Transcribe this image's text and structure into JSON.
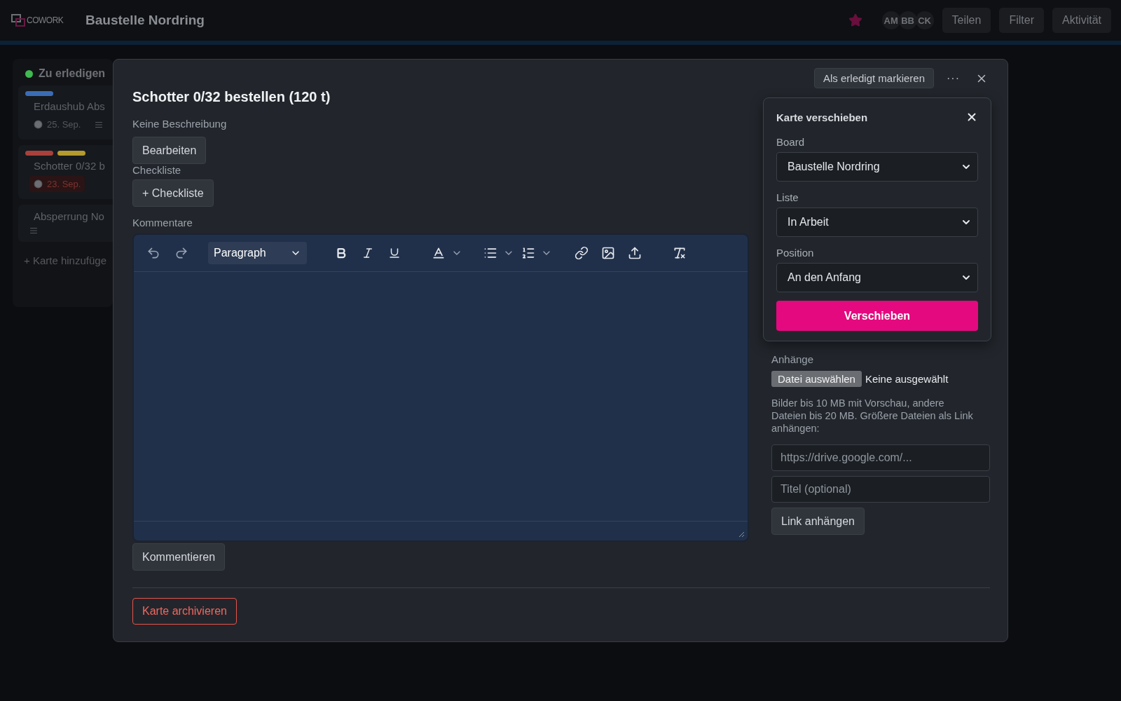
{
  "header": {
    "logo_text": "COWORK",
    "title": "Baustelle Nordring",
    "starred": true,
    "avatars": [
      "AM",
      "BB",
      "CK"
    ],
    "buttons": [
      "Teilen",
      "Filter",
      "Aktivität"
    ]
  },
  "list": {
    "title": "Zu erledigen",
    "color": "#3fb950",
    "cards": [
      {
        "labels": [
          {
            "color": "#3a6db5"
          }
        ],
        "title": "Erdaushub Abs",
        "due": "25. Sep.",
        "overdue": false,
        "has_description": true
      },
      {
        "labels": [
          {
            "color": "#a8403c"
          },
          {
            "color": "#b59a2e"
          }
        ],
        "title": "Schotter 0/32 b",
        "due": "23. Sep.",
        "overdue": true,
        "has_description": false
      },
      {
        "title": "Absperrung No",
        "has_description": true
      }
    ],
    "add_card": "+ Karte hinzufüge"
  },
  "modal": {
    "title": "Schotter 0/32 bestellen (120 t)",
    "done_button": "Als erledigt markieren",
    "more": "···",
    "description": "Keine Beschreibung",
    "edit_button": "Bearbeiten",
    "checklist_label": "Checkliste",
    "checklist_button": "+ Checkliste",
    "comments_label": "Kommentare",
    "editor": {
      "format": "Paragraph"
    },
    "comment_button": "Kommentieren",
    "archive_button": "Karte archivieren",
    "attachments": {
      "label": "Anhänge",
      "file_button": "Datei auswählen",
      "file_status": "Keine ausgewählt",
      "hint": "Bilder bis 10 MB mit Vorschau, andere Dateien bis 20 MB. Größere Dateien als Link anhängen:",
      "url_placeholder": "https://drive.google.com/...",
      "title_placeholder": "Titel (optional)",
      "link_button": "Link anhängen"
    }
  },
  "move_popover": {
    "title": "Karte verschieben",
    "fields": [
      {
        "label": "Board",
        "value": "Baustelle Nordring"
      },
      {
        "label": "Liste",
        "value": "In Arbeit"
      },
      {
        "label": "Position",
        "value": "An den Anfang"
      }
    ],
    "submit": "Verschieben"
  }
}
